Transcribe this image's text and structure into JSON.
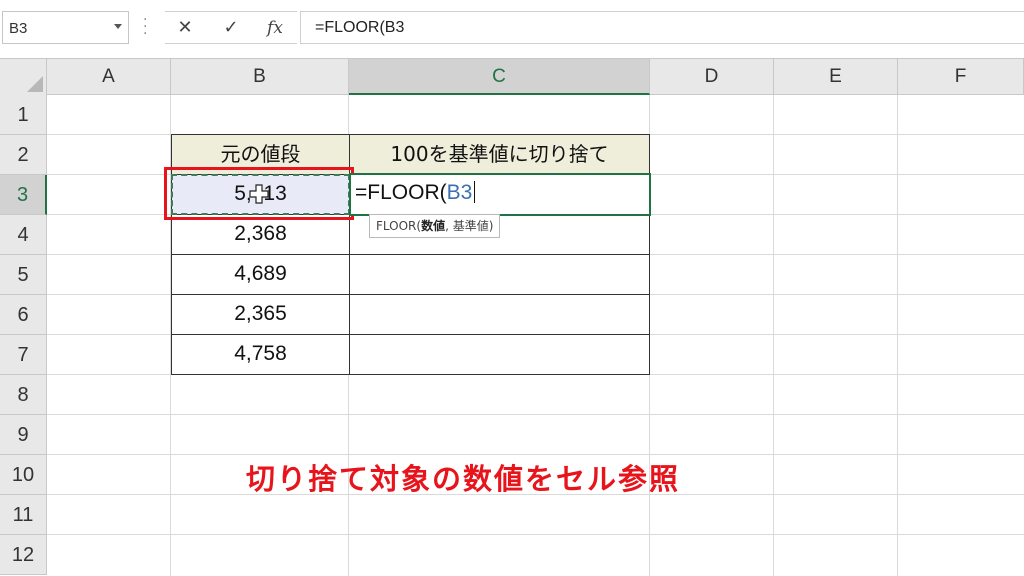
{
  "formula_bar": {
    "name_box": "B3",
    "cancel_icon": "✕",
    "enter_icon": "✓",
    "fx_icon": "fx",
    "formula": "=FLOOR(B3"
  },
  "columns": [
    "A",
    "B",
    "C",
    "D",
    "E",
    "F"
  ],
  "rows": [
    "1",
    "2",
    "3",
    "4",
    "5",
    "6",
    "7",
    "8",
    "9",
    "10",
    "11",
    "12"
  ],
  "table": {
    "header_b": "元の値段",
    "header_c": "100を基準値に切り捨て",
    "values": [
      "5,413",
      "2,368",
      "4,689",
      "2,365",
      "4,758"
    ]
  },
  "edit_cell": {
    "prefix": "=FLOOR(",
    "ref": "B3"
  },
  "tooltip": {
    "func": "FLOOR(",
    "arg1": "数値",
    "rest": ", 基準値)"
  },
  "caption": "切り捨て対象の数値をセル参照",
  "colors": {
    "accent_green": "#217346",
    "highlight_red": "#e8141c",
    "header_fill": "#eeeedb",
    "ref_blue": "#3a6fb0"
  }
}
